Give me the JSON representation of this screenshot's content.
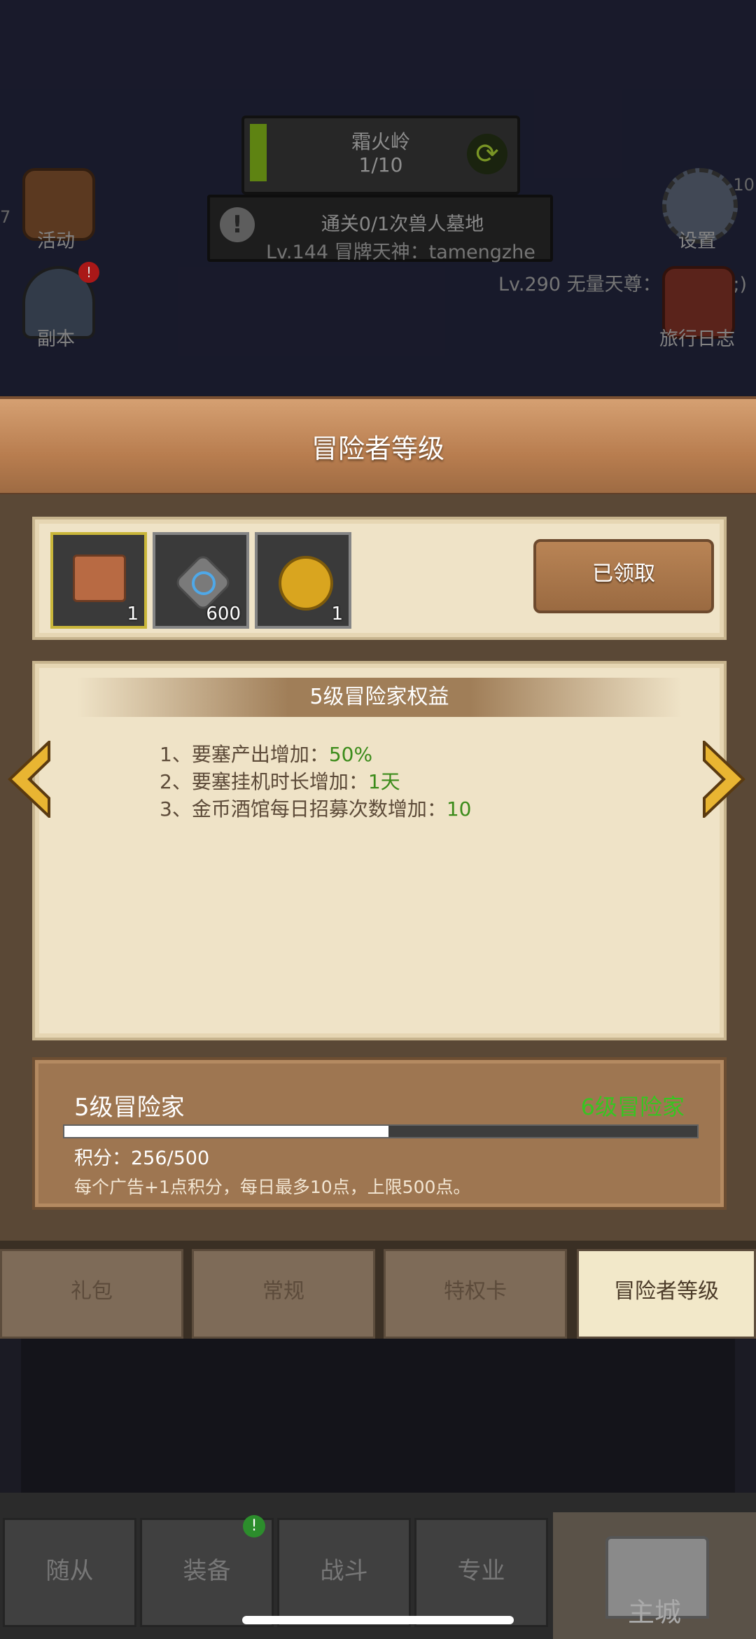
{
  "top": {
    "stage_name": "霜火岭",
    "stage_progress": "1/10",
    "stage_progress_fraction": 0.1,
    "quest": "通关0/1次兽人墓地",
    "chat_line_1": "Lv.144 冒牌天神：tamengzhe",
    "chat_line_2": "Lv.290 无量天尊：(っ °Д °;)",
    "left_buttons": [
      {
        "label": "活动",
        "icon": "event-icon"
      },
      {
        "label": "副本",
        "icon": "dungeon-icon"
      }
    ],
    "right_buttons": [
      {
        "label": "设置",
        "icon": "gear-icon"
      },
      {
        "label": "旅行日志",
        "icon": "journal-icon"
      }
    ],
    "level_badge": "Lv.10",
    "edge_number": "7"
  },
  "panel": {
    "title": "冒险者等级",
    "rewards": [
      {
        "icon": "skill-book-icon",
        "count": "1",
        "selected": true
      },
      {
        "icon": "rune-stone-icon",
        "count": "600",
        "selected": false
      },
      {
        "icon": "gold-medal-icon",
        "count": "1",
        "selected": false
      }
    ],
    "claim_button": "已领取",
    "benefit_title": "5级冒险家权益",
    "benefits": [
      {
        "text": "1、要塞产出增加：",
        "value": "50%"
      },
      {
        "text": "2、要塞挂机时长增加：",
        "value": "1天"
      },
      {
        "text": "3、金币酒馆每日招募次数增加：",
        "value": "10"
      }
    ],
    "current_level": "5级冒险家",
    "next_level": "6级冒险家",
    "points_label": "积分：256/500",
    "points_fraction": 0.512,
    "hint": "每个广告+1点积分，每日最多10点，上限500点。"
  },
  "tabs": [
    "礼包",
    "常规",
    "特权卡",
    "冒险者等级"
  ],
  "active_tab": "冒险者等级",
  "bottom_nav": [
    "随从",
    "装备",
    "战斗",
    "专业",
    "主城"
  ],
  "colors": {
    "accent_green": "#38c421",
    "value_green": "#3b8b1a",
    "header_wood": "#c08a5c"
  }
}
